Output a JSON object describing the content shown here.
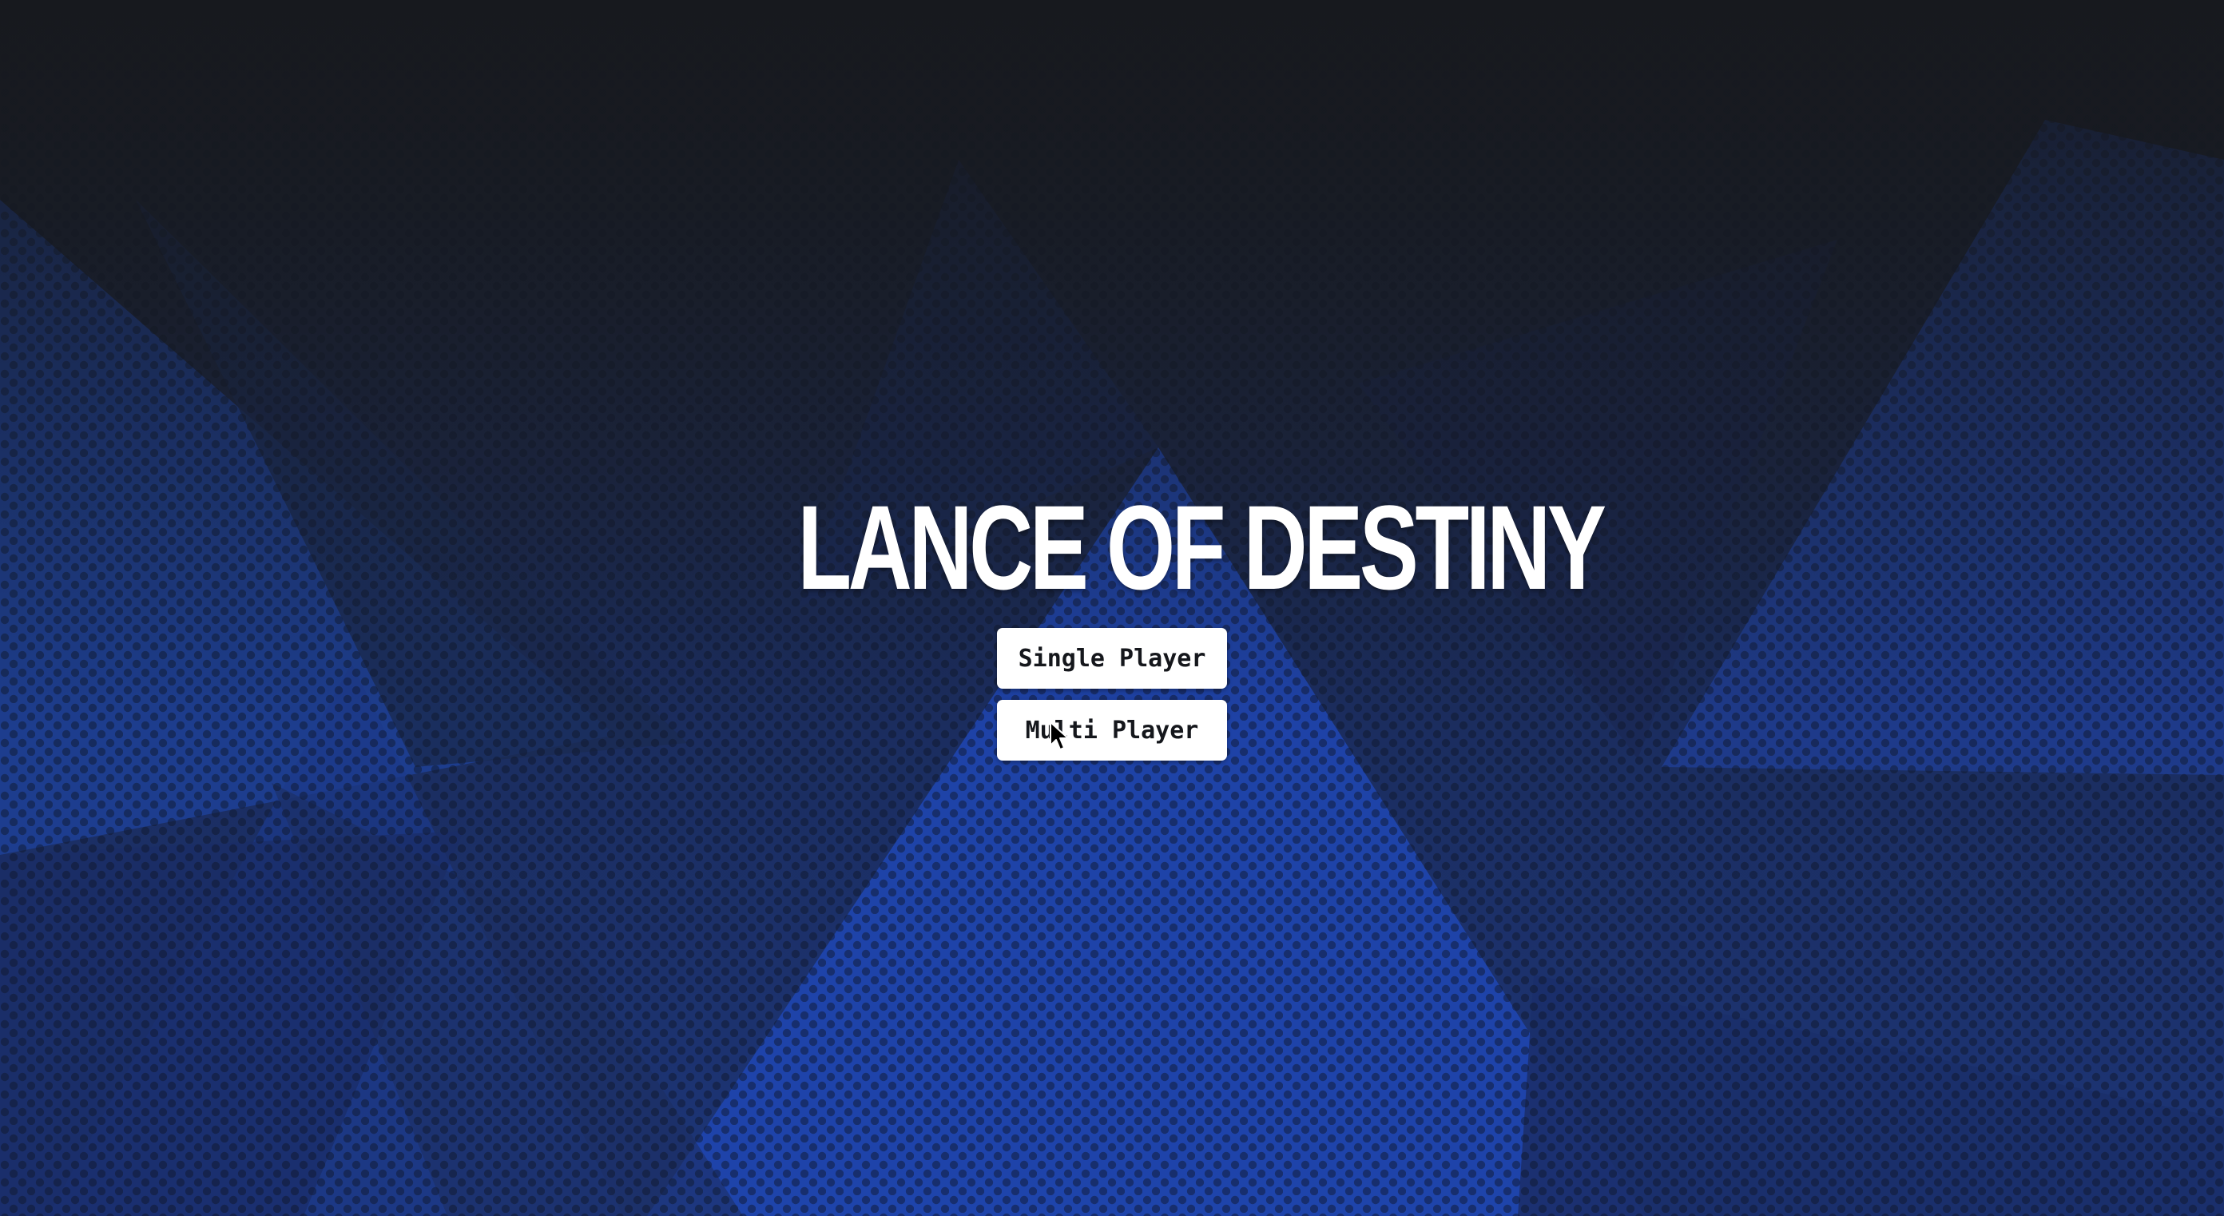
{
  "game": {
    "title": "LANCE OF DESTINY"
  },
  "menu": {
    "single_player_label": "Single Player",
    "multi_player_label": "Multi Player"
  },
  "theme": {
    "title_color": "#ffffff",
    "button_bg": "#ffffff",
    "button_text": "#15171c",
    "bg_dark": "#1a1c22",
    "bg_blue": "#1c3a96"
  },
  "pointer": {
    "icon": "mouse-cursor-icon",
    "hovering": "multi-player-button"
  }
}
